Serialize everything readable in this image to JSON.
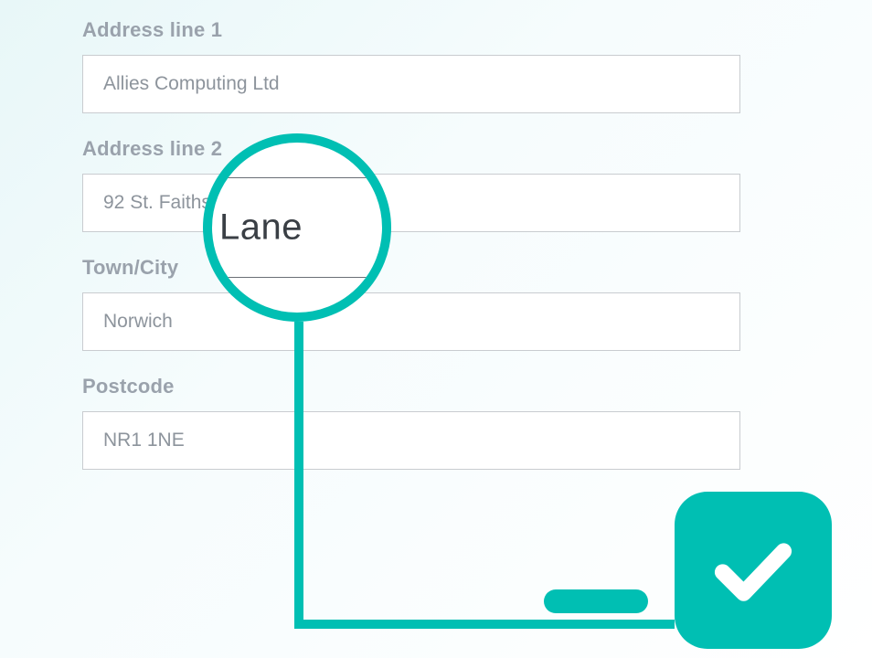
{
  "form": {
    "address1": {
      "label": "Address line 1",
      "value": "Allies Computing Ltd"
    },
    "address2": {
      "label": "Address line 2",
      "value": "92 St. Faiths Lane"
    },
    "town": {
      "label": "Town/City",
      "value": "Norwich"
    },
    "postcode": {
      "label": "Postcode",
      "value": "NR1 1NE"
    }
  },
  "magnifier": {
    "text": "Lane"
  },
  "accent": "#00bfb3"
}
